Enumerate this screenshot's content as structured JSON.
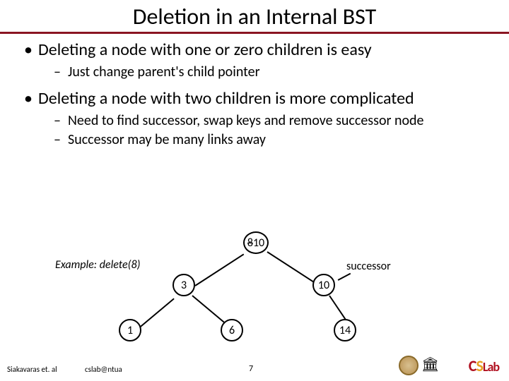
{
  "title": "Deletion in an Internal BST",
  "bullets": {
    "b1": "Deleting a node with one or zero children is easy",
    "s1": "Just change parent's child pointer",
    "b2": "Deleting a node with two children is more complicated",
    "s2": "Need to find successor, swap keys and remove successor node",
    "s3": "Successor may be many links away"
  },
  "diagram": {
    "example_label": "Example:",
    "example_call": "delete(8)",
    "successor_label": "successor",
    "root_old": "8",
    "root_new": "10",
    "n3": "3",
    "n10": "10",
    "n1": "1",
    "n6": "6",
    "n14": "14"
  },
  "footer": {
    "authors": "Siakavaras et. al",
    "email": "cslab@ntua",
    "page": "7"
  },
  "chart_data": {
    "type": "tree",
    "title": "Example: delete(8)",
    "annotations": [
      "successor points to node 10 (right child of root)"
    ],
    "nodes": [
      {
        "id": "root",
        "label_before": "8",
        "label_after": "10",
        "children": [
          "3",
          "10"
        ]
      },
      {
        "id": "3",
        "label": "3",
        "children": [
          "1",
          "6"
        ]
      },
      {
        "id": "10",
        "label": "10",
        "children": [
          "14"
        ],
        "role": "successor"
      },
      {
        "id": "1",
        "label": "1",
        "children": []
      },
      {
        "id": "6",
        "label": "6",
        "children": []
      },
      {
        "id": "14",
        "label": "14",
        "children": []
      }
    ]
  }
}
